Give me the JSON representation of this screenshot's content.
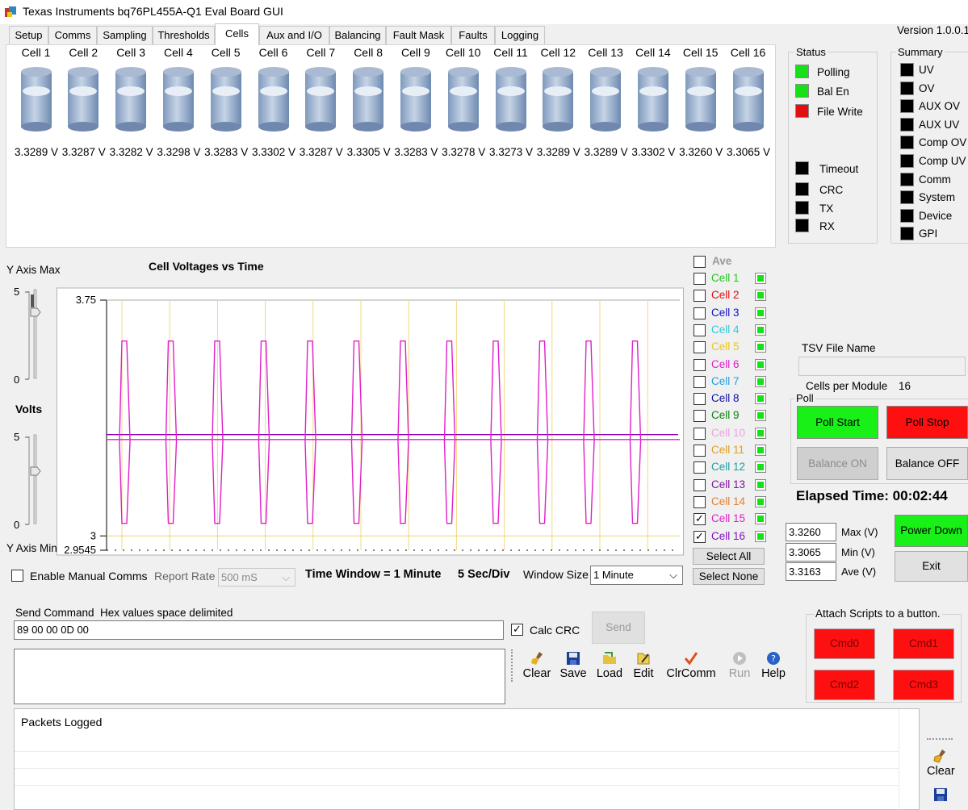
{
  "window": {
    "title": "Texas Instruments bq76PL455A-Q1 Eval Board GUI",
    "version": "Version 1.0.0.1"
  },
  "tabs": [
    {
      "label": "Setup"
    },
    {
      "label": "Comms"
    },
    {
      "label": "Sampling"
    },
    {
      "label": "Thresholds"
    },
    {
      "label": "Cells"
    },
    {
      "label": "Aux and I/O"
    },
    {
      "label": "Balancing"
    },
    {
      "label": "Fault Mask"
    },
    {
      "label": "Faults"
    },
    {
      "label": "Logging"
    }
  ],
  "active_tab": "Cells",
  "cells": [
    {
      "label": "Cell 1",
      "voltage": "3.3289 V"
    },
    {
      "label": "Cell 2",
      "voltage": "3.3287 V"
    },
    {
      "label": "Cell 3",
      "voltage": "3.3282 V"
    },
    {
      "label": "Cell 4",
      "voltage": "3.3298 V"
    },
    {
      "label": "Cell 5",
      "voltage": "3.3283 V"
    },
    {
      "label": "Cell 6",
      "voltage": "3.3302 V"
    },
    {
      "label": "Cell 7",
      "voltage": "3.3287 V"
    },
    {
      "label": "Cell 8",
      "voltage": "3.3305 V"
    },
    {
      "label": "Cell 9",
      "voltage": "3.3283 V"
    },
    {
      "label": "Cell 10",
      "voltage": "3.3278 V"
    },
    {
      "label": "Cell 11",
      "voltage": "3.3273 V"
    },
    {
      "label": "Cell 12",
      "voltage": "3.3289 V"
    },
    {
      "label": "Cell 13",
      "voltage": "3.3289 V"
    },
    {
      "label": "Cell 14",
      "voltage": "3.3302 V"
    },
    {
      "label": "Cell 15",
      "voltage": "3.3260 V"
    },
    {
      "label": "Cell 16",
      "voltage": "3.3065 V"
    }
  ],
  "status": {
    "title": "Status",
    "items": [
      {
        "label": "Polling",
        "color": "#18e018"
      },
      {
        "label": "Bal En",
        "color": "#18e018"
      },
      {
        "label": "File Write",
        "color": "#e01010"
      },
      {
        "label": "Timeout",
        "color": "#000000"
      },
      {
        "label": "CRC",
        "color": "#000000"
      },
      {
        "label": "TX",
        "color": "#000000"
      },
      {
        "label": "RX",
        "color": "#000000"
      }
    ]
  },
  "summary": {
    "title": "Summary",
    "items": [
      {
        "label": "UV"
      },
      {
        "label": "OV"
      },
      {
        "label": "AUX OV"
      },
      {
        "label": "AUX UV"
      },
      {
        "label": "Comp OV"
      },
      {
        "label": "Comp UV"
      },
      {
        "label": "Comm"
      },
      {
        "label": "System"
      },
      {
        "label": "Device"
      },
      {
        "label": "GPI"
      }
    ]
  },
  "chart_controls": {
    "y_axis_max": "Y Axis Max",
    "y_axis_min": "Y Axis Min",
    "volts": "Volts",
    "slider_top": "5",
    "slider_bottom": "0"
  },
  "chart_data": {
    "type": "line",
    "title": "Cell Voltages vs Time",
    "ylim": [
      2.9545,
      3.75
    ],
    "yticks": [
      "3.75",
      "3",
      "2.9545"
    ],
    "xlabel": "",
    "ylabel": "",
    "grid": "vertical",
    "series": [
      {
        "name": "Cell 15",
        "color": "#8b00b0",
        "baseline": 3.326,
        "style": "flat"
      },
      {
        "name": "Cell 16",
        "color": "#e020c8",
        "baseline": 3.3065,
        "style": "spikes",
        "spike_high": 3.62,
        "spike_low": 3.04,
        "spike_count": 12
      }
    ]
  },
  "legend": {
    "ave": "Ave",
    "items": [
      {
        "label": "Cell 1",
        "color": "#22c822",
        "checked": false
      },
      {
        "label": "Cell 2",
        "color": "#e01010",
        "checked": false
      },
      {
        "label": "Cell 3",
        "color": "#1010c8",
        "checked": false
      },
      {
        "label": "Cell 4",
        "color": "#30c8e0",
        "checked": false
      },
      {
        "label": "Cell 5",
        "color": "#e8c820",
        "checked": false
      },
      {
        "label": "Cell 6",
        "color": "#e020c8",
        "checked": false
      },
      {
        "label": "Cell 7",
        "color": "#20a0e0",
        "checked": false
      },
      {
        "label": "Cell 8",
        "color": "#1010a0",
        "checked": false
      },
      {
        "label": "Cell 9",
        "color": "#108010",
        "checked": false
      },
      {
        "label": "Cell 10",
        "color": "#f0a0e0",
        "checked": false
      },
      {
        "label": "Cell 11",
        "color": "#e0a020",
        "checked": false
      },
      {
        "label": "Cell 12",
        "color": "#20a0a0",
        "checked": false
      },
      {
        "label": "Cell 13",
        "color": "#8010a0",
        "checked": false
      },
      {
        "label": "Cell 14",
        "color": "#e08030",
        "checked": false
      },
      {
        "label": "Cell 15",
        "color": "#e020c8",
        "checked": true
      },
      {
        "label": "Cell 16",
        "color": "#8010c0",
        "checked": true
      }
    ],
    "select_all": "Select All",
    "select_none": "Select None"
  },
  "file": {
    "tsv_label": "TSV File Name",
    "tsv_value": "",
    "cells_per_module_label": "Cells per Module",
    "cells_per_module": "16"
  },
  "poll": {
    "title": "Poll",
    "start": "Poll Start",
    "stop": "Poll Stop",
    "balance_on": "Balance ON",
    "balance_off": "Balance OFF",
    "elapsed": "Elapsed Time: 00:02:44"
  },
  "stats": [
    {
      "value": "3.3260",
      "label": "Max (V)"
    },
    {
      "value": "3.3065",
      "label": "Min (V)"
    },
    {
      "value": "3.3163",
      "label": "Ave (V)"
    }
  ],
  "power_down": "Power Down",
  "exit": "Exit",
  "comms": {
    "enable_manual": "Enable Manual Comms",
    "report_rate_label": "Report Rate",
    "report_rate": "500 mS",
    "time_window": "Time Window = 1 Minute",
    "sec_div": "5 Sec/Div",
    "window_size_label": "Window Size",
    "window_size": "1 Minute"
  },
  "send": {
    "label": "Send Command",
    "hint": "Hex values space delimited",
    "value": "89 00 00 0D 00",
    "calc_crc": "Calc CRC",
    "send_btn": "Send"
  },
  "toolbar": [
    {
      "label": "Clear",
      "icon": "broom-icon"
    },
    {
      "label": "Save",
      "icon": "floppy-icon"
    },
    {
      "label": "Load",
      "icon": "folder-icon"
    },
    {
      "label": "Edit",
      "icon": "edit-icon"
    },
    {
      "label": "ClrComm",
      "icon": "check-icon"
    },
    {
      "label": "Run",
      "icon": "play-icon"
    },
    {
      "label": "Help",
      "icon": "help-icon"
    }
  ],
  "scripts": {
    "title": "Attach Scripts to a button.",
    "buttons": [
      "Cmd0",
      "Cmd1",
      "Cmd2",
      "Cmd3"
    ]
  },
  "log": {
    "title": "Packets Logged",
    "clear": "Clear"
  }
}
